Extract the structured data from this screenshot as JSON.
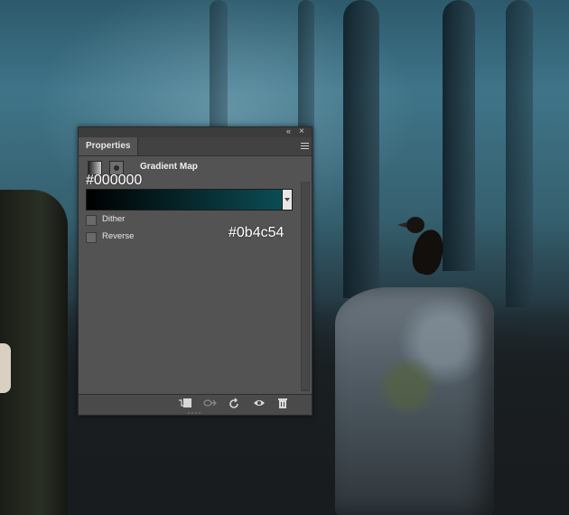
{
  "panel": {
    "title": "Properties",
    "adjustment_title": "Gradient Map",
    "gradient": {
      "start_color": "#000000",
      "end_color": "#0b4c54",
      "start_label": "#000000",
      "end_label": "#0b4c54"
    },
    "options": [
      {
        "label": "Dither",
        "checked": false
      },
      {
        "label": "Reverse",
        "checked": false
      }
    ],
    "window_controls": {
      "collapse": "«",
      "close": "×"
    },
    "bottom_icons": [
      "clip-to-layer-icon",
      "view-previous-state-icon",
      "reset-icon",
      "visibility-eye-icon",
      "trash-icon"
    ]
  }
}
